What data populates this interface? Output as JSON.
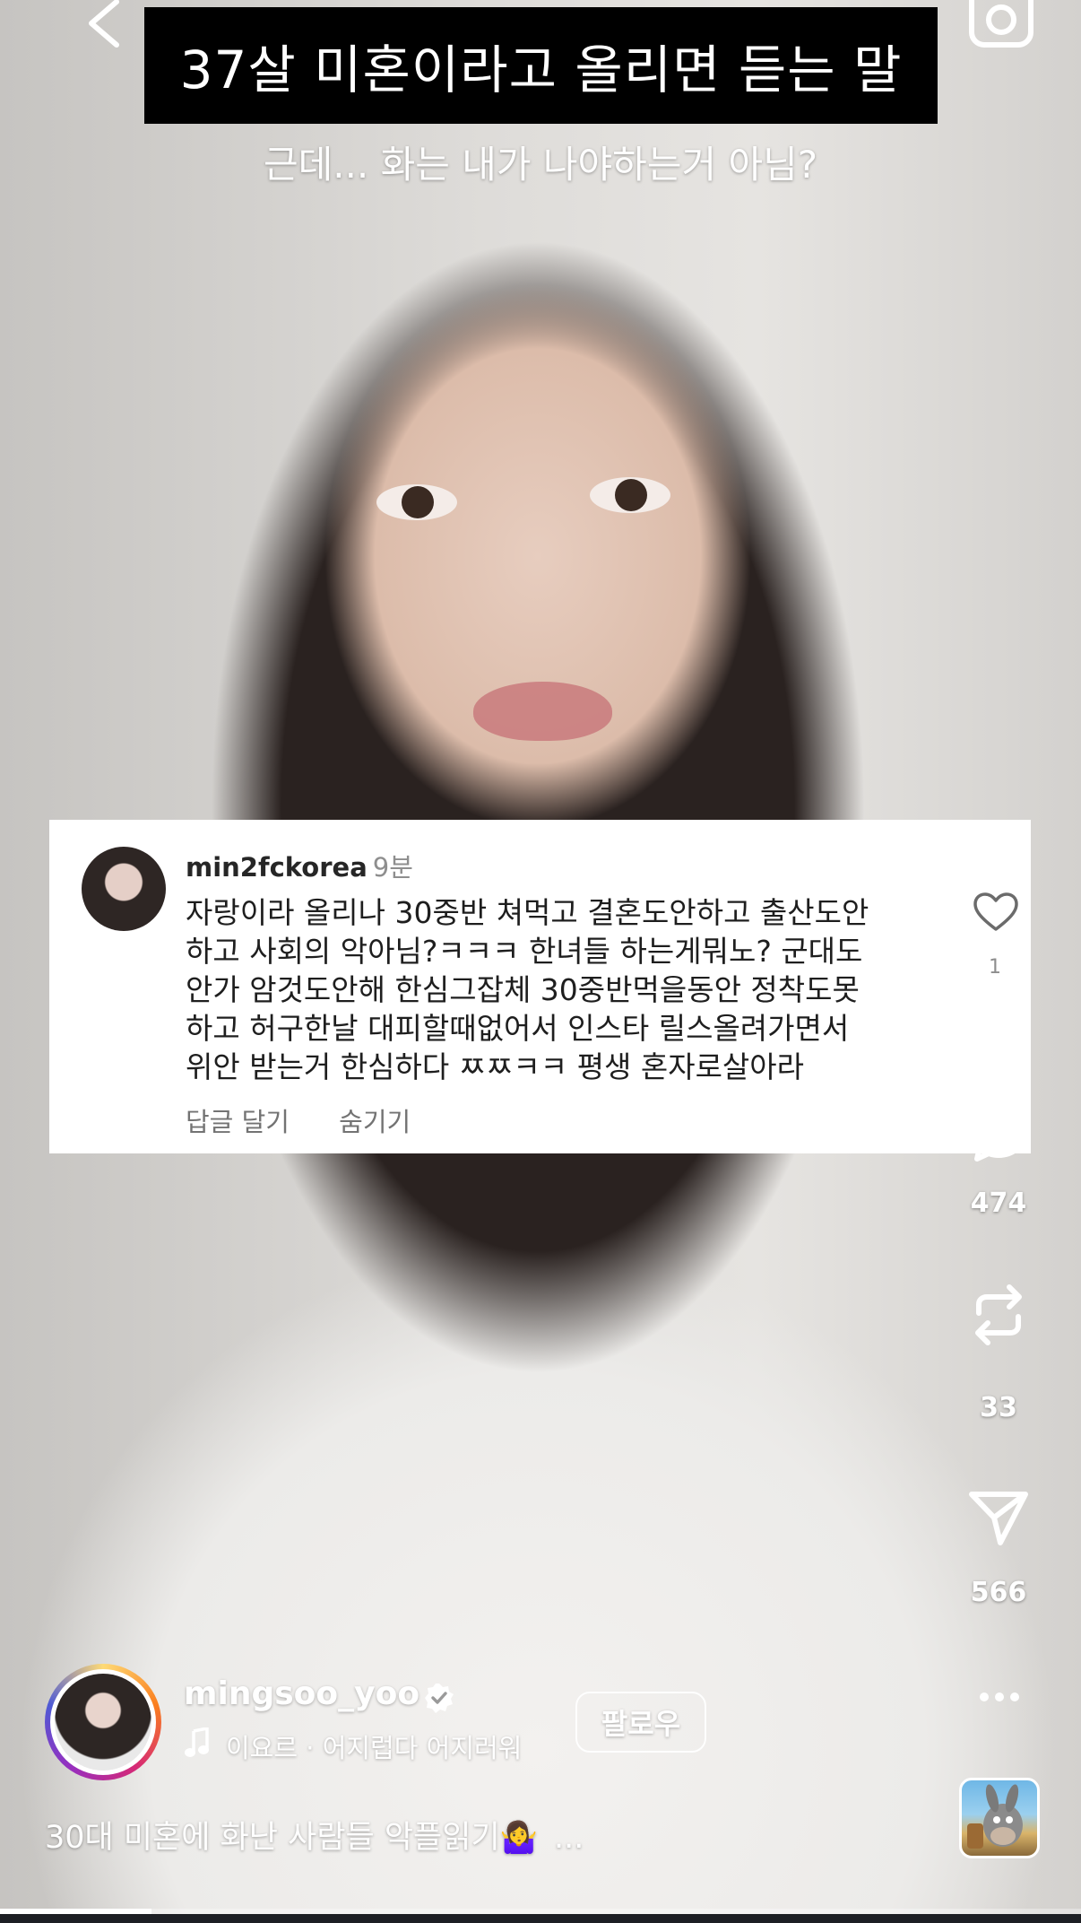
{
  "overlay": {
    "title": "37살 미혼이라고 올리면 듣는 말",
    "subtitle": "근데... 화는 내가 나야하는거 아님?"
  },
  "comment": {
    "username": "min2fckorea",
    "time": "9분",
    "lines": [
      "자랑이라 올리나 30중반 쳐먹고 결혼도안하고 출산도안",
      "하고 사회의 악아님?ㅋㅋㅋ 한녀들 하는게뭐노? 군대도",
      "안가 암것도안해 한심그잡체 30중반먹을동안 정착도못",
      "하고 허구한날 대피할때없어서 인스타 릴스올려가면서",
      "위안 받는거 한심하다 ㅉㅉㅋㅋ 평생 혼자로살아라"
    ],
    "reply_label": "답글 달기",
    "hide_label": "숨기기",
    "like_count": "1"
  },
  "rail": {
    "comments_count": "474",
    "reposts_count": "33",
    "shares_count": "566"
  },
  "author": {
    "username": "mingsoo_yoo",
    "follow_label": "팔로우",
    "music": "이요르 · 어지럽다 어지러워"
  },
  "caption": {
    "text": "30대 미혼에 화난 사람들 악플읽기",
    "emoji": "🤷‍♀️",
    "more": "..."
  },
  "icons": {
    "back": "chevron-left-icon",
    "camera": "camera-icon",
    "like": "heart-icon",
    "comment": "comment-bubble-icon",
    "repost": "repost-icon",
    "share": "send-icon",
    "more": "more-horizontal-icon",
    "verified": "verified-badge-icon",
    "music": "music-note-icon"
  },
  "playback": {
    "progress_fraction": 0.14
  }
}
